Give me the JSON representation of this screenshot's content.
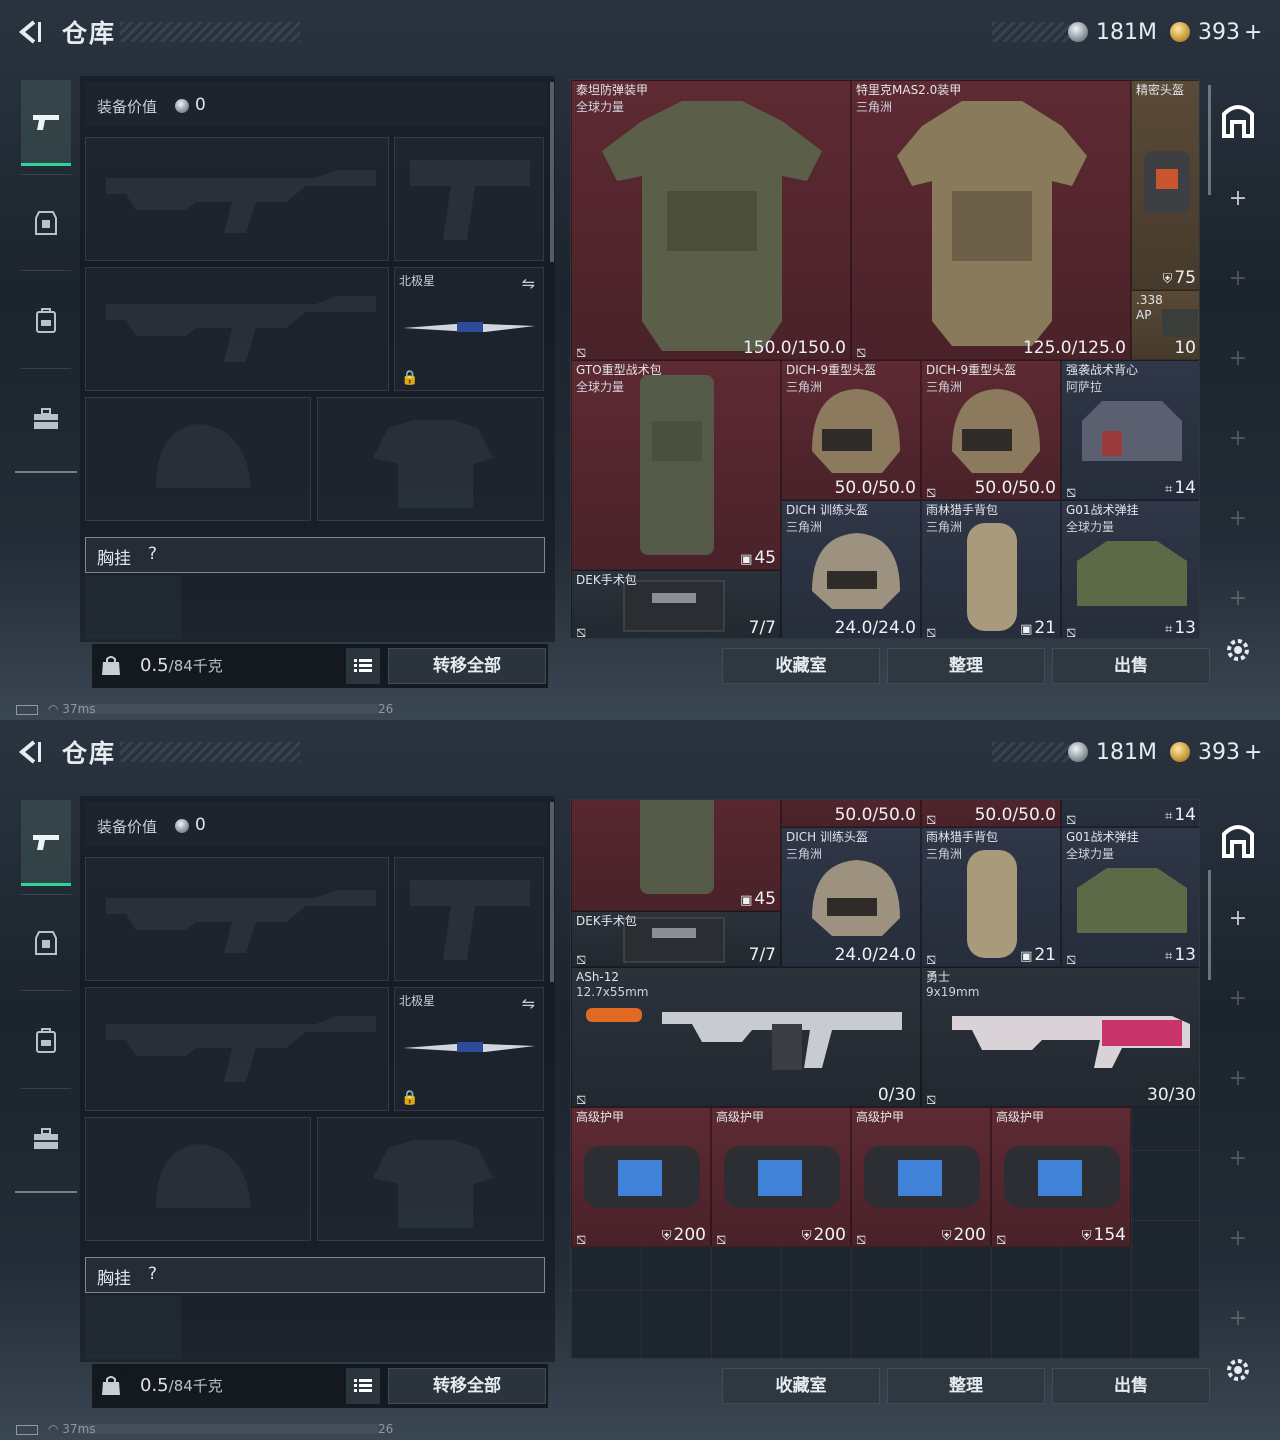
{
  "header": {
    "title": "仓库",
    "currency_silver": "181M",
    "currency_gold": "393"
  },
  "nav": [
    "pistol",
    "armor",
    "backpack",
    "case"
  ],
  "equipment": {
    "value_label": "装备价值",
    "value": "0",
    "melee_name": "北极星",
    "chest_label": "胸挂",
    "chest_hint": "?"
  },
  "bottom": {
    "weight": "0.5",
    "weight_max": "/84千克",
    "transfer_label": "转移全部"
  },
  "actions": {
    "collection": "收藏室",
    "organize": "整理",
    "sell": "出售"
  },
  "status": {
    "ping": "37ms",
    "fps": "26"
  },
  "screen1_items": [
    {
      "name": "泰坦防弹装甲",
      "sub": "全球力量",
      "value": "150.0/150.0"
    },
    {
      "name": "特里克MAS2.0装甲",
      "sub": "三角洲",
      "value": "125.0/125.0"
    },
    {
      "name": "精密头盔",
      "value": "75"
    },
    {
      "name": ".338 AP",
      "value": "10"
    },
    {
      "name": "GTO重型战术包",
      "sub": "全球力量",
      "value": "45"
    },
    {
      "name": "DICH-9重型头盔",
      "sub": "三角洲",
      "value": "50.0/50.0"
    },
    {
      "name": "DICH-9重型头盔",
      "sub": "三角洲",
      "value": "50.0/50.0"
    },
    {
      "name": "强袭战术背心",
      "sub": "阿萨拉",
      "value": "14"
    },
    {
      "name": "DICH 训练头盔",
      "sub": "三角洲",
      "value": "24.0/24.0"
    },
    {
      "name": "雨林猎手背包",
      "sub": "三角洲",
      "value": "21"
    },
    {
      "name": "G01战术弹挂",
      "sub": "全球力量",
      "value": "13"
    },
    {
      "name": "DEK手术包",
      "value": "7/7"
    }
  ],
  "screen2_items": [
    {
      "value": "50.0/50.0"
    },
    {
      "value": "50.0/50.0"
    },
    {
      "value": "14"
    },
    {
      "value": "45"
    },
    {
      "name": "DICH 训练头盔",
      "sub": "三角洲",
      "value": "24.0/24.0"
    },
    {
      "name": "雨林猎手背包",
      "sub": "三角洲",
      "value": "21"
    },
    {
      "name": "G01战术弹挂",
      "sub": "全球力量",
      "value": "13"
    },
    {
      "name": "DEK手术包",
      "value": "7/7"
    },
    {
      "name": "ASh-12",
      "sub": "12.7x55mm",
      "value": "0/30"
    },
    {
      "name": "勇士",
      "sub": "9x19mm",
      "value": "30/30"
    },
    {
      "name": "高级护甲",
      "value": "200"
    },
    {
      "name": "高级护甲",
      "value": "200"
    },
    {
      "name": "高级护甲",
      "value": "200"
    },
    {
      "name": "高级护甲",
      "value": "154"
    }
  ]
}
